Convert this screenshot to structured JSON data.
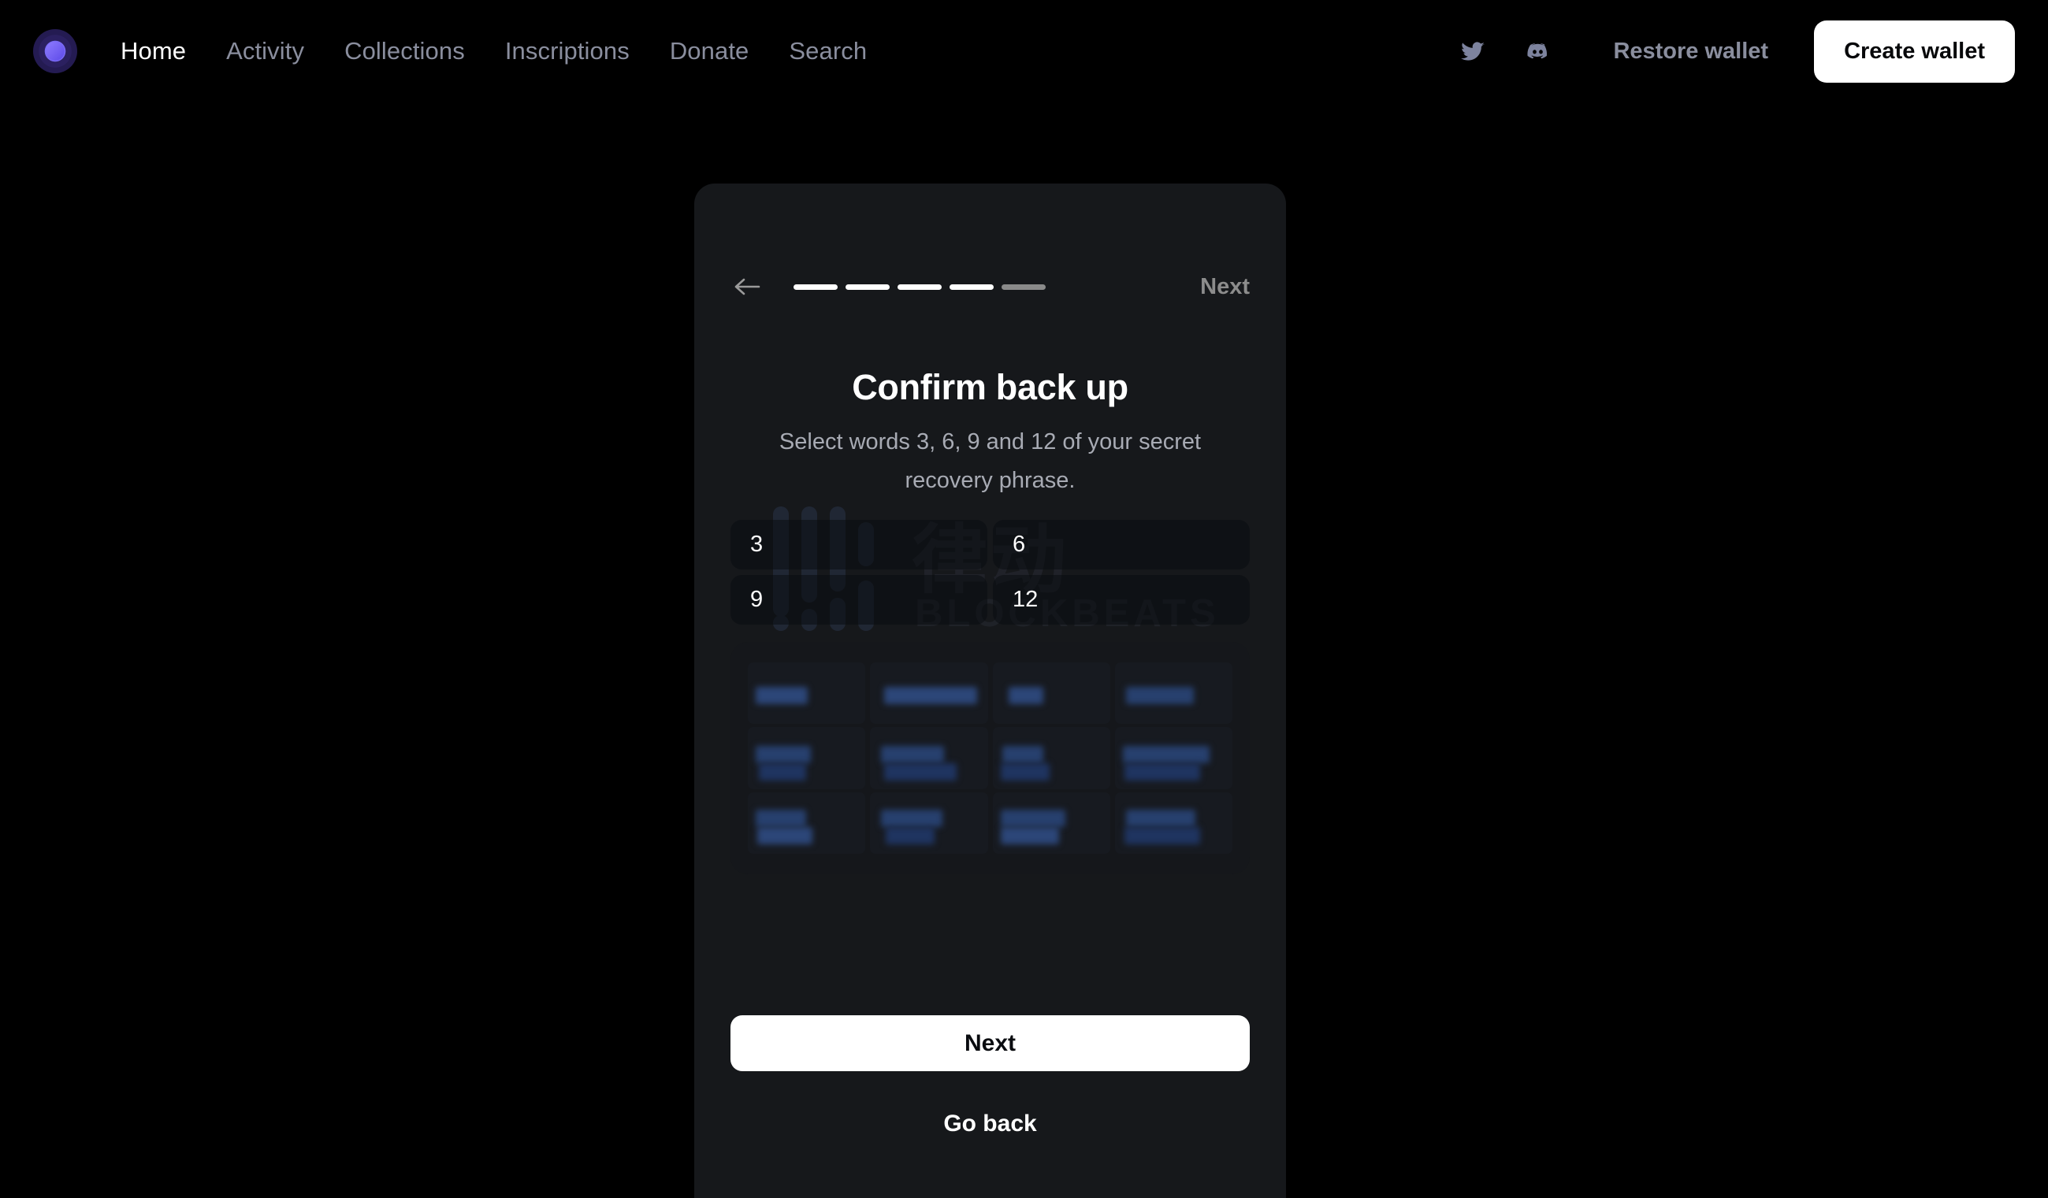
{
  "nav": {
    "logo_icon": "orb-logo-icon",
    "links": [
      {
        "label": "Home",
        "active": true
      },
      {
        "label": "Activity",
        "active": false
      },
      {
        "label": "Collections",
        "active": false
      },
      {
        "label": "Inscriptions",
        "active": false
      },
      {
        "label": "Donate",
        "active": false
      },
      {
        "label": "Search",
        "active": false
      }
    ],
    "social": [
      {
        "icon": "twitter-icon"
      },
      {
        "icon": "discord-icon"
      }
    ],
    "restore_wallet_label": "Restore wallet",
    "create_wallet_label": "Create wallet"
  },
  "modal": {
    "back_icon": "arrow-left-icon",
    "next_top_label": "Next",
    "progress": {
      "total_steps": 5,
      "completed_steps": 4
    },
    "title": "Confirm back up",
    "subtitle": "Select words 3, 6, 9 and 12 of your secret recovery phrase.",
    "word_number_fields": [
      {
        "number": "3",
        "value": ""
      },
      {
        "number": "6",
        "value": ""
      },
      {
        "number": "9",
        "value": ""
      },
      {
        "number": "12",
        "value": ""
      }
    ],
    "word_bank": {
      "hidden": true,
      "rows": 3,
      "columns": 4,
      "chips": [
        {
          "id": "chip-1"
        },
        {
          "id": "chip-2"
        },
        {
          "id": "chip-3"
        },
        {
          "id": "chip-4"
        },
        {
          "id": "chip-5"
        },
        {
          "id": "chip-6"
        },
        {
          "id": "chip-7"
        },
        {
          "id": "chip-8"
        },
        {
          "id": "chip-9"
        },
        {
          "id": "chip-10"
        },
        {
          "id": "chip-11"
        },
        {
          "id": "chip-12"
        }
      ]
    },
    "next_button_label": "Next",
    "go_back_button_label": "Go back"
  },
  "watermark": {
    "chinese_text": "律动",
    "english_text": "BLOCKBEATS"
  },
  "colors": {
    "page_background": "#000000",
    "modal_background": "#16181b",
    "accent_white": "#ffffff",
    "muted_text": "#8a8e9e",
    "logo_purple": "#7a6bf5",
    "progress_inactive": "#8a8a8a"
  }
}
